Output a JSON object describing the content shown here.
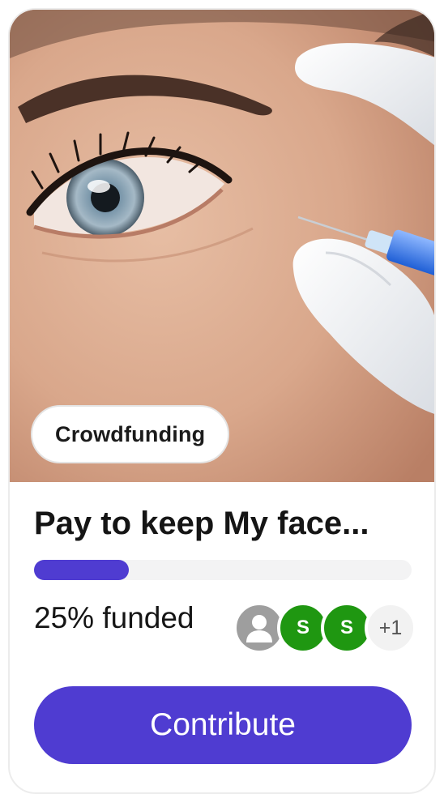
{
  "card": {
    "image_alt": "Close-up of an eye with a gloved hand holding a syringe",
    "tag": "Crowdfunding",
    "title": "Pay to keep My face...",
    "progress": 0.25,
    "funded_text": "25% funded",
    "supporters": [
      {
        "kind": "placeholder",
        "label": ""
      },
      {
        "kind": "initial",
        "label": "S",
        "color": "#1f9711"
      },
      {
        "kind": "initial",
        "label": "S",
        "color": "#1f9711"
      },
      {
        "kind": "more",
        "label": "+1"
      }
    ],
    "cta_label": "Contribute"
  },
  "colors": {
    "accent": "#4f3cd1",
    "avatar_green": "#1f9711"
  }
}
